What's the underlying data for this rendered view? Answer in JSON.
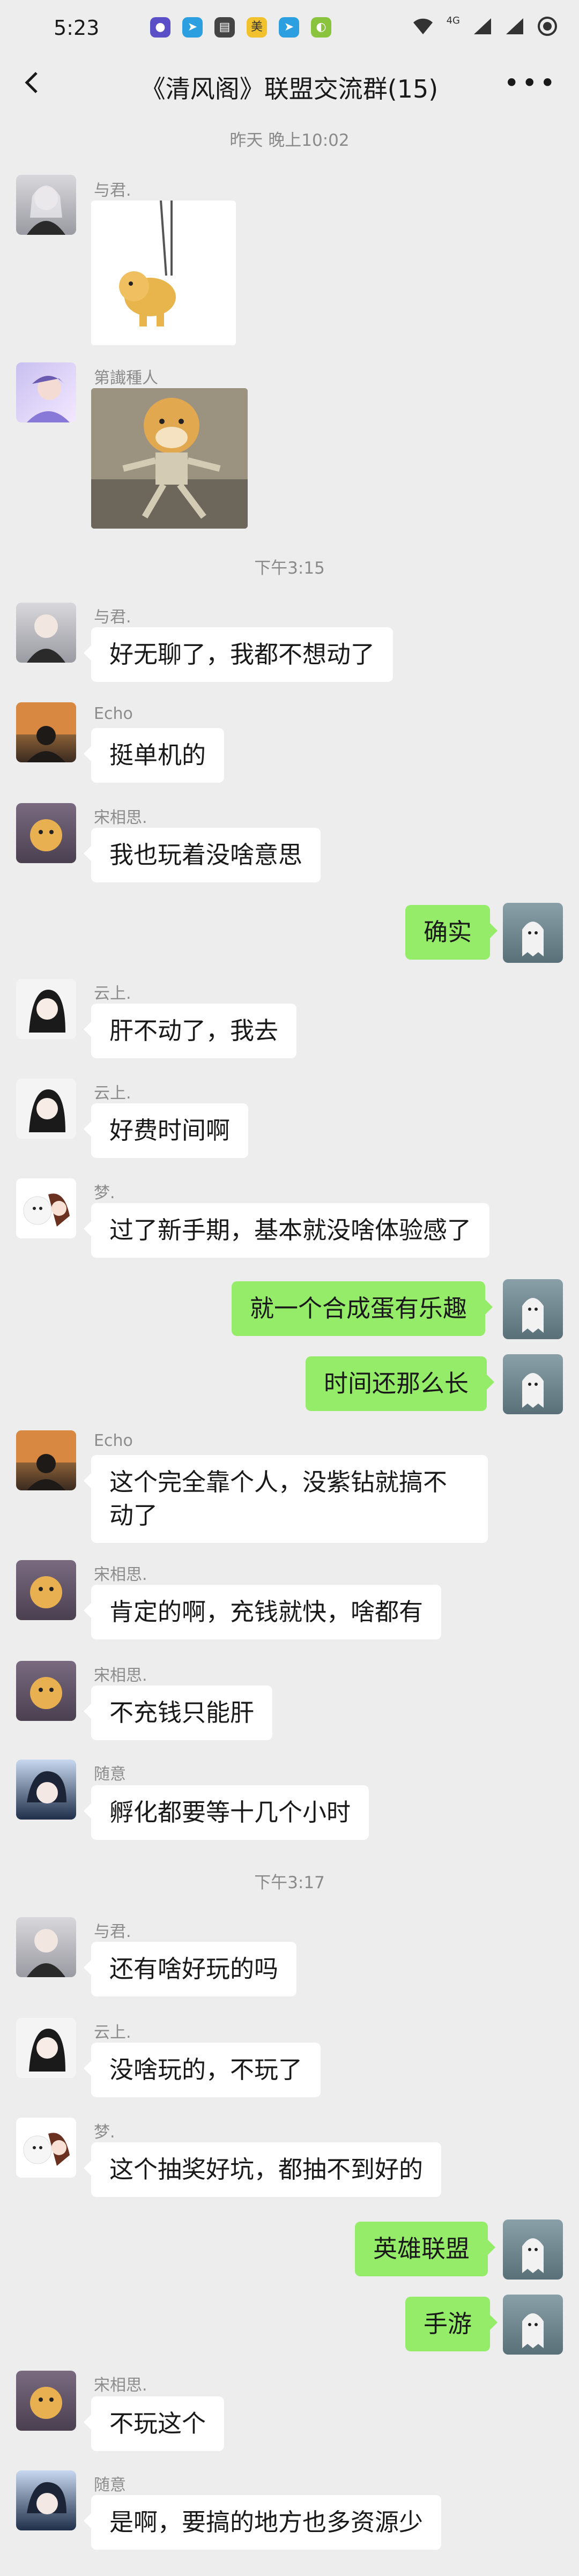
{
  "status_bar": {
    "time": "5:23",
    "network_label": "4G"
  },
  "header": {
    "title": "《清风阁》联盟交流群(15)"
  },
  "time_separators": [
    "昨天 晚上10:02",
    "下午3:15",
    "下午3:17"
  ],
  "messages": [
    {
      "sender": "与君.",
      "type": "image",
      "image": "doge-hanging-sticker"
    },
    {
      "sender": "第䜟種人",
      "type": "image",
      "image": "doge-dancing-sticker"
    },
    {
      "sender": "与君.",
      "text": "好无聊了，我都不想动了"
    },
    {
      "sender": "Echo",
      "text": "挺单机的"
    },
    {
      "sender": "宋相思.",
      "text": "我也玩着没啥意思"
    },
    {
      "sender": "self",
      "text": "确实"
    },
    {
      "sender": "云上.",
      "text": "肝不动了，我去"
    },
    {
      "sender": "云上.",
      "text": "好费时间啊"
    },
    {
      "sender": "梦.",
      "text": "过了新手期，基本就没啥体验感了"
    },
    {
      "sender": "self",
      "text": "就一个合成蛋有乐趣"
    },
    {
      "sender": "self",
      "text": "时间还那么长"
    },
    {
      "sender": "Echo",
      "text": "这个完全靠个人，没紫钻就搞不动了"
    },
    {
      "sender": "宋相思.",
      "text": "肯定的啊，充钱就快，啥都有"
    },
    {
      "sender": "宋相思.",
      "text": "不充钱只能肝"
    },
    {
      "sender": "随意",
      "text": "孵化都要等十几个小时"
    },
    {
      "sender": "与君.",
      "text": "还有啥好玩的吗"
    },
    {
      "sender": "云上.",
      "text": "没啥玩的，不玩了"
    },
    {
      "sender": "梦.",
      "text": "这个抽奖好坑，都抽不到好的"
    },
    {
      "sender": "self",
      "text": "英雄联盟"
    },
    {
      "sender": "self",
      "text": "手游"
    },
    {
      "sender": "宋相思.",
      "text": "不玩这个"
    },
    {
      "sender": "随意",
      "text": "是啊，要搞的地方也多资源少"
    }
  ],
  "colors": {
    "background": "#ededed",
    "self_bubble": "#95ec69",
    "other_bubble": "#ffffff"
  }
}
